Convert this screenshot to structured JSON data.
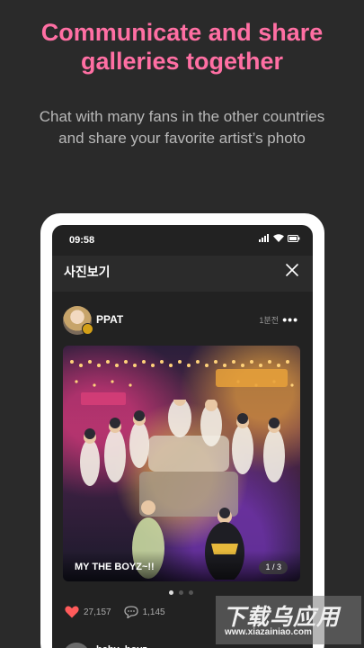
{
  "promo": {
    "headline_line1": "Communicate and share",
    "headline_line2": "galleries together",
    "subline_line1": "Chat with many fans in the other countries",
    "subline_line2": "and share your favorite artist’s photo",
    "accent_color": "#ff6fa3"
  },
  "status_bar": {
    "time": "09:58",
    "icons": [
      "signal-icon",
      "wifi-icon",
      "battery-icon"
    ]
  },
  "app_bar": {
    "title": "사진보기",
    "close_icon": "close-icon"
  },
  "post": {
    "username": "PPAT",
    "time_ago": "1분전",
    "more_label": "•••",
    "caption": "MY THE BOYZ~!!",
    "counter": "1 / 3",
    "pager_dots": 3,
    "active_dot": 0,
    "likes": "27,157",
    "comments": "1,145",
    "like_color": "#ff5b5b"
  },
  "next_post": {
    "username": "baby_boyz"
  },
  "watermark": {
    "big": "下载乌应用",
    "small": "www.xiazainiao.com"
  }
}
